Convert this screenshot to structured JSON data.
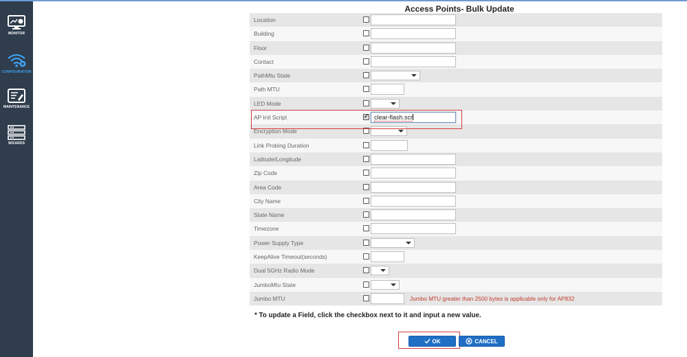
{
  "sidebar": {
    "items": [
      {
        "label": "MONITOR",
        "icon": "monitor-icon",
        "active": false
      },
      {
        "label": "CONFIGURATION",
        "icon": "wifi-config-icon",
        "active": true
      },
      {
        "label": "MAINTENANCE",
        "icon": "maintenance-icon",
        "active": false
      },
      {
        "label": "WIZARDS",
        "icon": "wizards-icon",
        "active": false
      }
    ]
  },
  "page": {
    "title": "Access Points- Bulk Update"
  },
  "fields": {
    "location": {
      "label": "Location",
      "checked": false,
      "type": "text",
      "value": ""
    },
    "building": {
      "label": "Building",
      "checked": false,
      "type": "text",
      "value": ""
    },
    "floor": {
      "label": "Floor",
      "checked": false,
      "type": "text",
      "value": ""
    },
    "contact": {
      "label": "Contact",
      "checked": false,
      "type": "text",
      "value": ""
    },
    "pathmtu_state": {
      "label": "PathMtu State",
      "checked": false,
      "type": "select",
      "value": ""
    },
    "path_mtu": {
      "label": "Path MTU",
      "checked": false,
      "type": "text",
      "value": ""
    },
    "led_mode": {
      "label": "LED Mode",
      "checked": false,
      "type": "select",
      "value": ""
    },
    "ap_init_script": {
      "label": "AP Init Script",
      "checked": true,
      "type": "text",
      "value": "clear-flash.scr"
    },
    "encryption_mode": {
      "label": "Encryption Mode",
      "checked": false,
      "type": "select",
      "value": ""
    },
    "link_probing_duration": {
      "label": "Link Probing Duration",
      "checked": false,
      "type": "text",
      "value": ""
    },
    "lat_long": {
      "label": "Latitude/Longitude",
      "checked": false,
      "type": "text",
      "value": ""
    },
    "zip_code": {
      "label": "Zip Code",
      "checked": false,
      "type": "text",
      "value": ""
    },
    "area_code": {
      "label": "Area Code",
      "checked": false,
      "type": "text",
      "value": ""
    },
    "city_name": {
      "label": "City Name",
      "checked": false,
      "type": "text",
      "value": ""
    },
    "state_name": {
      "label": "State Name",
      "checked": false,
      "type": "text",
      "value": ""
    },
    "timezone": {
      "label": "Timezone",
      "checked": false,
      "type": "text",
      "value": ""
    },
    "power_supply_type": {
      "label": "Power Supply Type",
      "checked": false,
      "type": "select",
      "value": ""
    },
    "keepalive_timeout": {
      "label": "KeepAlive Timeout(seconds)",
      "checked": false,
      "type": "text",
      "value": ""
    },
    "dual_5ghz_radio_mode": {
      "label": "Dual 5GHz Radio Mode",
      "checked": false,
      "type": "select",
      "value": ""
    },
    "jumbomtu_state": {
      "label": "JumboMtu State",
      "checked": false,
      "type": "select",
      "value": ""
    },
    "jumbo_mtu": {
      "label": "Jumbo MTU",
      "checked": false,
      "type": "text",
      "value": "",
      "warning": "Jumbo MTU greater than 2500 bytes is applicable only for AP832"
    }
  },
  "note": "* To update a Field, click the checkbox next to it and input a new value.",
  "buttons": {
    "ok": "OK",
    "cancel": "CANCEL"
  },
  "colors": {
    "sidebar": "#2f3d4c",
    "accent": "#1f6fc5",
    "highlight": "#d13a3a",
    "active_nav": "#3fa3f2"
  }
}
